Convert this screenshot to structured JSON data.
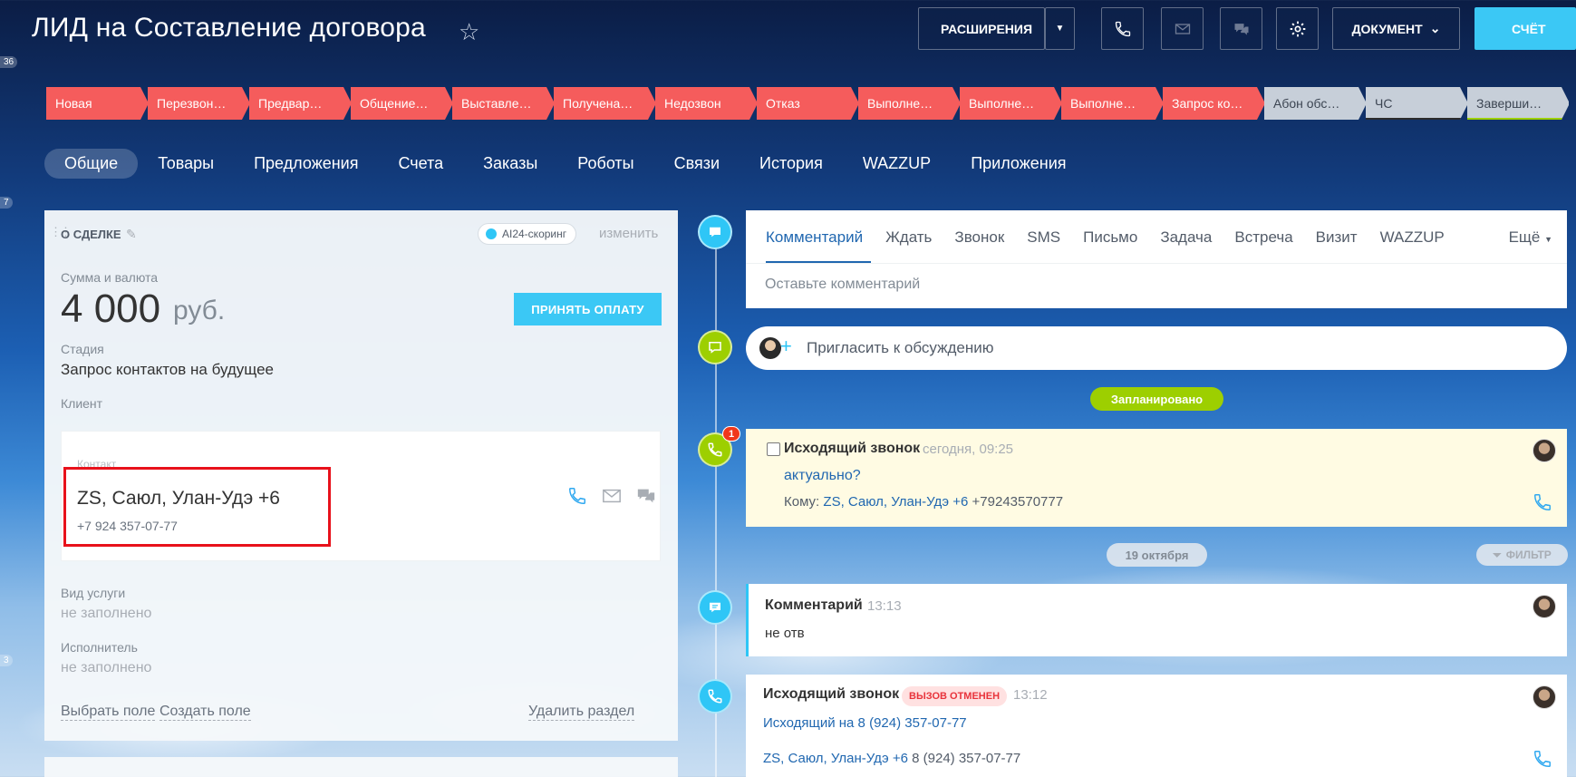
{
  "header": {
    "title": "ЛИД на Составление договора",
    "extensions_label": "РАСШИРЕНИЯ",
    "document_label": "ДОКУМЕНТ",
    "invoice_label": "СЧЁТ"
  },
  "left_strip": {
    "badge1": "36",
    "badge2": "7",
    "badge3": "3"
  },
  "stages": [
    {
      "label": "Новая",
      "color": "red"
    },
    {
      "label": "Перезвон…",
      "color": "red"
    },
    {
      "label": "Предвар…",
      "color": "red"
    },
    {
      "label": "Общение…",
      "color": "red"
    },
    {
      "label": "Выставле…",
      "color": "red"
    },
    {
      "label": "Получена…",
      "color": "red"
    },
    {
      "label": "Недозвон",
      "color": "red"
    },
    {
      "label": "Отказ",
      "color": "red"
    },
    {
      "label": "Выполне…",
      "color": "red"
    },
    {
      "label": "Выполне…",
      "color": "red"
    },
    {
      "label": "Выполне…",
      "color": "red"
    },
    {
      "label": "Запрос ко…",
      "color": "red"
    },
    {
      "label": "Абон обс…",
      "color": "grey"
    },
    {
      "label": "ЧС",
      "color": "grey"
    },
    {
      "label": "Заверши…",
      "color": "grey"
    }
  ],
  "tabs": [
    "Общие",
    "Товары",
    "Предложения",
    "Счета",
    "Заказы",
    "Роботы",
    "Связи",
    "История",
    "WAZZUP",
    "Приложения"
  ],
  "deal": {
    "section_title": "О СДЕЛКЕ",
    "ai_chip": "AI24-скоринг",
    "change_link": "изменить",
    "amount_label": "Сумма и валюта",
    "amount": "4 000",
    "currency": "руб.",
    "pay_button": "ПРИНЯТЬ ОПЛАТУ",
    "stage_label": "Стадия",
    "stage_value": "Запрос контактов на будущее",
    "client_label": "Клиент",
    "contact_label": "Контакт",
    "contact_name": "ZS, Саюл, Улан-Удэ +6",
    "contact_phone": "+7 924 357-07-77",
    "service_label": "Вид услуги",
    "service_value": "не заполнено",
    "executor_label": "Исполнитель",
    "executor_value": "не заполнено",
    "select_field": "Выбрать поле",
    "create_field": "Создать поле",
    "delete_section": "Удалить раздел"
  },
  "composer": {
    "tabs": [
      "Комментарий",
      "Ждать",
      "Звонок",
      "SMS",
      "Письмо",
      "Задача",
      "Встреча",
      "Визит",
      "WAZZUP"
    ],
    "more": "Ещё",
    "placeholder": "Оставьте комментарий"
  },
  "invite": {
    "text": "Пригласить к обсуждению"
  },
  "planned_label": "Запланировано",
  "planned_count": "1",
  "planned_call": {
    "title": "Исходящий звонок",
    "time": "сегодня, 09:25",
    "subject": "актуально?",
    "to_label": "Кому:",
    "to_name": "ZS, Саюл, Улан-Удэ +6",
    "to_phone": "+79243570777"
  },
  "date_divider": "19 октября",
  "filter_label": "ФИЛЬТР",
  "comment_event": {
    "title": "Комментарий",
    "time": "13:13",
    "text": "не отв"
  },
  "call_event": {
    "title": "Исходящий звонок",
    "tag": "ВЫЗОВ ОТМЕНЕН",
    "time": "13:12",
    "subject": "Исходящий на 8 (924) 357-07-77",
    "contact_name": "ZS, Саюл, Улан-Удэ +6",
    "contact_phone": "8 (924) 357-07-77"
  },
  "colors": {
    "stage_red": "#f55c5c",
    "stage_grey": "#c7cfd9",
    "accent_blue": "#3bc8f5",
    "link": "#2067b0",
    "green": "#9dcf00",
    "highlight_red": "#e8111b"
  }
}
